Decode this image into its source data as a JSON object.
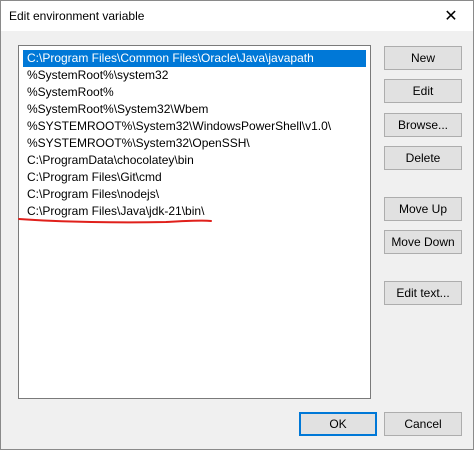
{
  "window": {
    "title": "Edit environment variable",
    "close_glyph": "✕"
  },
  "list": {
    "items": [
      "C:\\Program Files\\Common Files\\Oracle\\Java\\javapath",
      "%SystemRoot%\\system32",
      "%SystemRoot%",
      "%SystemRoot%\\System32\\Wbem",
      "%SYSTEMROOT%\\System32\\WindowsPowerShell\\v1.0\\",
      "%SYSTEMROOT%\\System32\\OpenSSH\\",
      "C:\\ProgramData\\chocolatey\\bin",
      "C:\\Program Files\\Git\\cmd",
      "C:\\Program Files\\nodejs\\",
      "C:\\Program Files\\Java\\jdk-21\\bin\\"
    ],
    "selected_index": 0
  },
  "buttons": {
    "new": "New",
    "edit": "Edit",
    "browse": "Browse...",
    "delete": "Delete",
    "move_up": "Move Up",
    "move_down": "Move Down",
    "edit_text": "Edit text...",
    "ok": "OK",
    "cancel": "Cancel"
  },
  "colors": {
    "selection": "#0078d7",
    "annotation": "#e0201b"
  }
}
